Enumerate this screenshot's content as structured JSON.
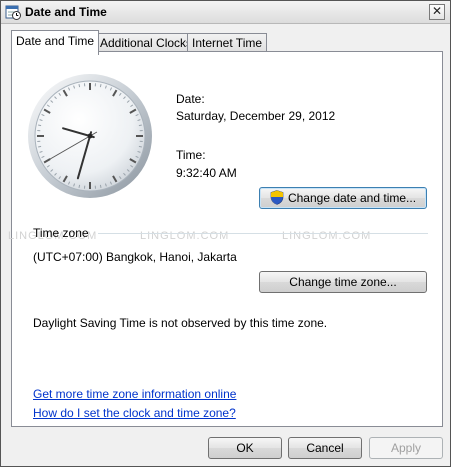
{
  "window": {
    "title": "Date and Time"
  },
  "tabs": [
    {
      "label": "Date and Time"
    },
    {
      "label": "Additional Clocks"
    },
    {
      "label": "Internet Time"
    }
  ],
  "date": {
    "label": "Date:",
    "value": "Saturday, December 29, 2012"
  },
  "time": {
    "label": "Time:",
    "value": "9:32:40 AM"
  },
  "buttons": {
    "change_datetime": "Change date and time...",
    "change_timezone": "Change time zone...",
    "ok": "OK",
    "cancel": "Cancel",
    "apply": "Apply"
  },
  "timezone": {
    "group_label": "Time zone",
    "value": "(UTC+07:00) Bangkok, Hanoi, Jakarta",
    "dst_note": "Daylight Saving Time is not observed by this time zone."
  },
  "links": {
    "more_info": "Get more time zone information online",
    "how_to": "How do I set the clock and time zone?"
  },
  "watermark": {
    "text": "LINGLOM.COM"
  },
  "clock": {
    "hours": 9,
    "minutes": 32,
    "seconds": 40
  }
}
